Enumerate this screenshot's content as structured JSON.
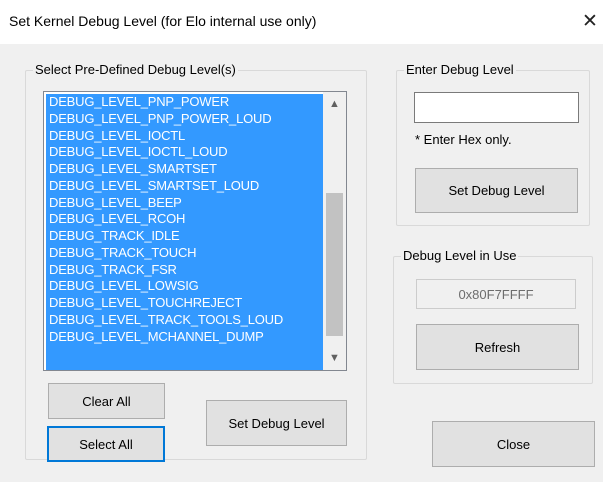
{
  "window": {
    "title": "Set Kernel Debug Level (for Elo internal use only)",
    "close_glyph": "✕",
    "close_icon": "close-icon"
  },
  "predefined": {
    "label": "Select Pre-Defined Debug Level(s)",
    "items": [
      "DEBUG_LEVEL_PNP_POWER",
      "DEBUG_LEVEL_PNP_POWER_LOUD",
      "DEBUG_LEVEL_IOCTL",
      "DEBUG_LEVEL_IOCTL_LOUD",
      "DEBUG_LEVEL_SMARTSET",
      "DEBUG_LEVEL_SMARTSET_LOUD",
      "DEBUG_LEVEL_BEEP",
      "DEBUG_LEVEL_RCOH",
      "DEBUG_TRACK_IDLE",
      "DEBUG_TRACK_TOUCH",
      "DEBUG_TRACK_FSR",
      "DEBUG_LEVEL_LOWSIG",
      "DEBUG_LEVEL_TOUCHREJECT",
      "DEBUG_LEVEL_TRACK_TOOLS_LOUD",
      "DEBUG_LEVEL_MCHANNEL_DUMP"
    ],
    "scroll_up_glyph": "▲",
    "scroll_down_glyph": "▼",
    "clear_all": "Clear All",
    "select_all": "Select All",
    "set_debug_level": "Set Debug Level"
  },
  "enter": {
    "label": "Enter Debug Level",
    "input_value": "",
    "hint": "* Enter Hex only.",
    "set_debug_level": "Set Debug Level"
  },
  "in_use": {
    "label": "Debug Level in Use",
    "value": "0x80F7FFFF",
    "refresh": "Refresh"
  },
  "footer": {
    "close": "Close"
  },
  "colors": {
    "selection": "#3399ff",
    "focus": "#0078d7"
  }
}
